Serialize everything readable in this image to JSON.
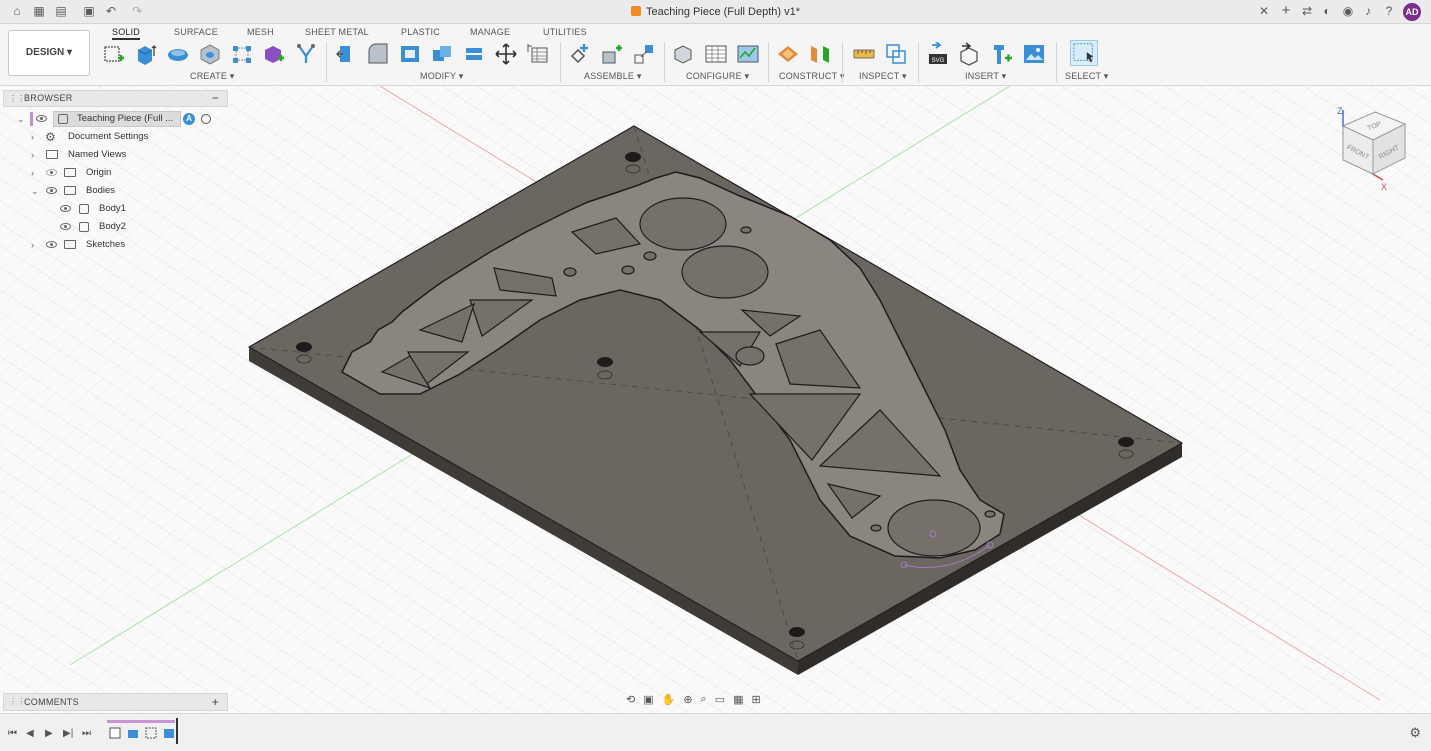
{
  "titlebar": {
    "document_title": "Teaching Piece (Full Depth) v1*",
    "avatar_initials": "AD",
    "close_glyph": "✕",
    "new_tab_glyph": "+"
  },
  "toolbar": {
    "workspace_label": "DESIGN ▾",
    "tabs": [
      "SOLID",
      "SURFACE",
      "MESH",
      "SHEET METAL",
      "PLASTIC",
      "MANAGE",
      "UTILITIES"
    ],
    "active_tab": "SOLID",
    "groups": [
      "CREATE ▾",
      "MODIFY ▾",
      "ASSEMBLE ▾",
      "CONFIGURE ▾",
      "CONSTRUCT ▾",
      "INSPECT ▾",
      "INSERT ▾",
      "SELECT ▾"
    ]
  },
  "browser": {
    "title": "BROWSER",
    "collapse_glyph": "−",
    "items": [
      {
        "label": "Teaching Piece (Full ...",
        "level": 0
      },
      {
        "label": "Document Settings",
        "level": 1
      },
      {
        "label": "Named Views",
        "level": 1
      },
      {
        "label": "Origin",
        "level": 1
      },
      {
        "label": "Bodies",
        "level": 1
      },
      {
        "label": "Body1",
        "level": 2
      },
      {
        "label": "Body2",
        "level": 2
      },
      {
        "label": "Sketches",
        "level": 1
      }
    ]
  },
  "comments": {
    "title": "COMMENTS",
    "add_glyph": "+"
  },
  "viewcube": {
    "top": "TOP",
    "front": "FRONT",
    "right": "RIGHT",
    "axis_z": "Z",
    "axis_x": "X"
  },
  "colors": {
    "accent": "#0696d7",
    "avatar": "#7b2d8e",
    "part": "#6a655f",
    "doc_icon": "#f08a24"
  }
}
